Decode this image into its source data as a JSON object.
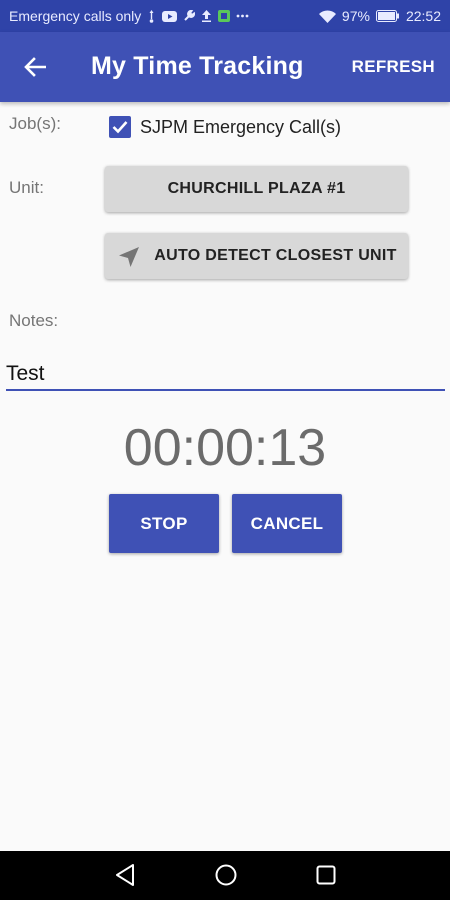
{
  "status_bar": {
    "carrier_text": "Emergency calls only",
    "battery_percent": "97%",
    "time": "22:52",
    "icons": [
      "usb-icon",
      "youtube-icon",
      "wrench-icon",
      "upload-icon",
      "app-notification-icon",
      "more-icon",
      "wifi-icon",
      "battery-icon"
    ]
  },
  "app_bar": {
    "title": "My Time Tracking",
    "refresh_label": "REFRESH",
    "back_icon": "arrow-back-icon"
  },
  "form": {
    "jobs_label": "Job(s):",
    "job_checkbox_label": "SJPM Emergency Call(s)",
    "job_checked": true,
    "unit_label": "Unit:",
    "unit_value": "CHURCHILL PLAZA #1",
    "auto_detect_label": "AUTO DETECT CLOSEST UNIT",
    "auto_detect_icon": "navigation-arrow-icon",
    "notes_label": "Notes:",
    "notes_value": "Test"
  },
  "timer": {
    "elapsed": "00:00:13"
  },
  "actions": {
    "stop_label": "STOP",
    "cancel_label": "CANCEL"
  },
  "system_nav": {
    "icons": [
      "back-triangle-icon",
      "home-circle-icon",
      "recents-square-icon"
    ]
  },
  "colors": {
    "primary": "#3f51b5",
    "status_bar": "#2f43a8",
    "underline": "#3f51b5"
  }
}
